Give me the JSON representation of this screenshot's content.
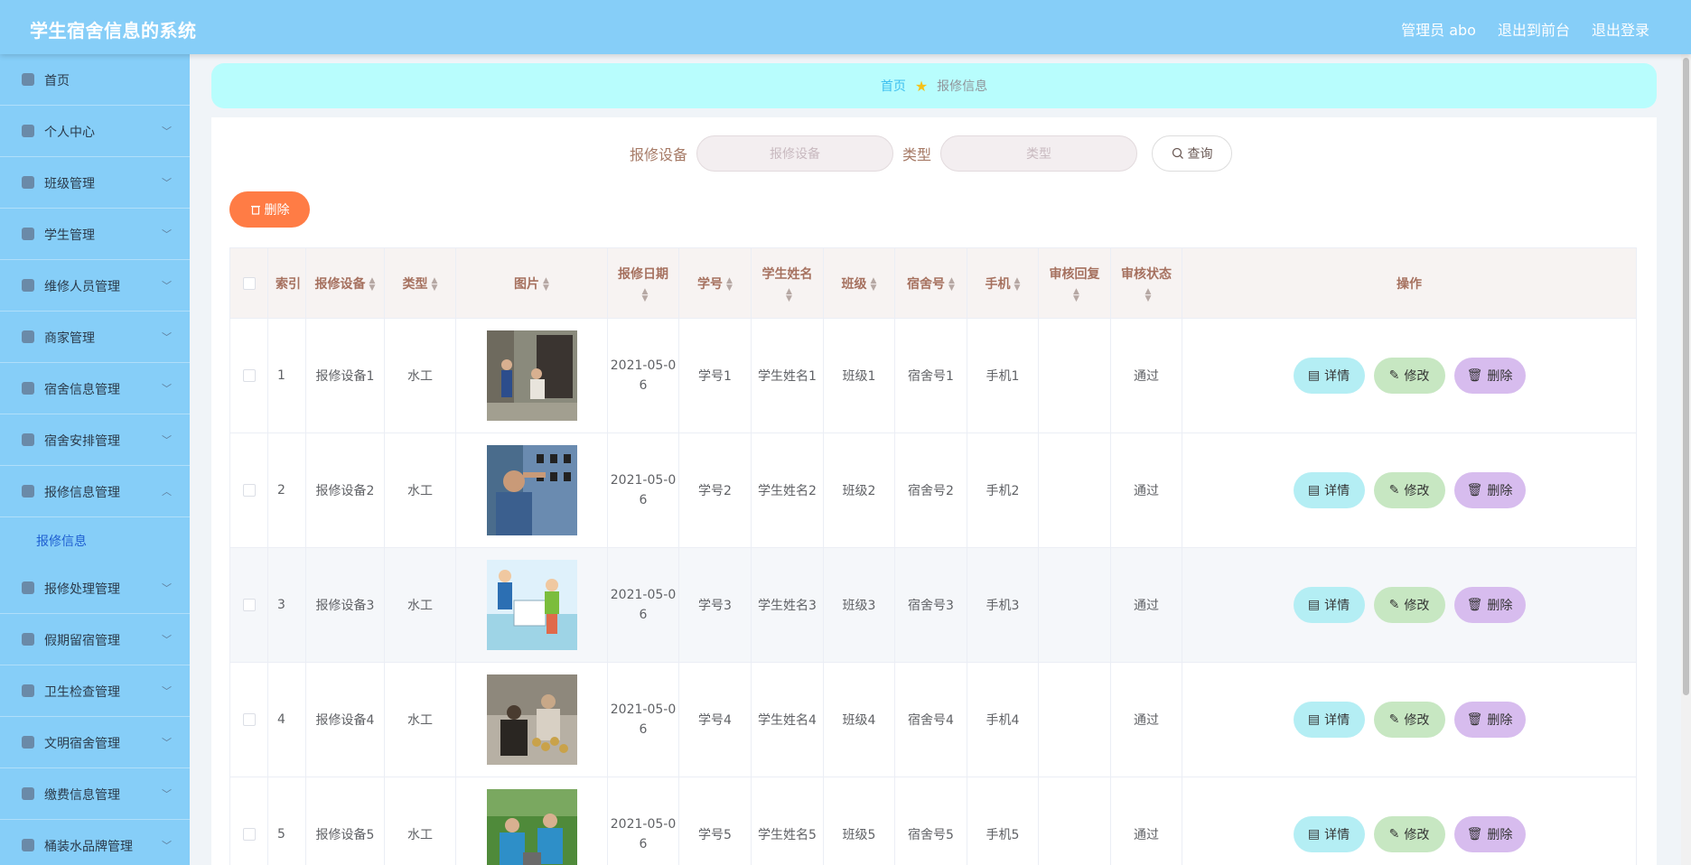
{
  "header": {
    "title": "学生宿舍信息的系统",
    "admin": "管理员 abo",
    "to_front": "退出到前台",
    "logout": "退出登录"
  },
  "sidebar": {
    "items": [
      {
        "label": "首页",
        "icon": "home-icon",
        "chevron": ""
      },
      {
        "label": "个人中心",
        "icon": "user-icon",
        "chevron": "﹀"
      },
      {
        "label": "班级管理",
        "icon": "grid-icon",
        "chevron": "﹀"
      },
      {
        "label": "学生管理",
        "icon": "clipboard-icon",
        "chevron": "﹀"
      },
      {
        "label": "维修人员管理",
        "icon": "tool-icon",
        "chevron": "﹀"
      },
      {
        "label": "商家管理",
        "icon": "mic-icon",
        "chevron": "﹀"
      },
      {
        "label": "宿舍信息管理",
        "icon": "compass-icon",
        "chevron": "﹀"
      },
      {
        "label": "宿舍安排管理",
        "icon": "message-icon",
        "chevron": "﹀"
      },
      {
        "label": "报修信息管理",
        "icon": "send-icon",
        "chevron": "︿"
      }
    ],
    "submenu": "报修信息",
    "items2": [
      {
        "label": "报修处理管理",
        "icon": "chart-icon",
        "chevron": "﹀"
      },
      {
        "label": "假期留宿管理",
        "icon": "location-icon",
        "chevron": "﹀"
      },
      {
        "label": "卫生检查管理",
        "icon": "ticket-icon",
        "chevron": "﹀"
      },
      {
        "label": "文明宿舍管理",
        "icon": "target-icon",
        "chevron": "﹀"
      },
      {
        "label": "缴费信息管理",
        "icon": "circle-icon",
        "chevron": "﹀"
      },
      {
        "label": "桶装水品牌管理",
        "icon": "suitcase-icon",
        "chevron": "﹀"
      }
    ]
  },
  "breadcrumb": {
    "home": "首页",
    "current": "报修信息"
  },
  "search": {
    "label1": "报修设备",
    "placeholder1": "报修设备",
    "label2": "类型",
    "placeholder2": "类型",
    "button": "查询"
  },
  "toolbar": {
    "delete": "删除"
  },
  "table": {
    "headers": [
      "索引",
      "报修设备",
      "类型",
      "图片",
      "报修日期",
      "学号",
      "学生姓名",
      "班级",
      "宿舍号",
      "手机",
      "审核回复",
      "审核状态",
      "操作"
    ],
    "rows": [
      {
        "idx": "1",
        "device": "报修设备1",
        "type": "水工",
        "date1": "2021-05-0",
        "date2": "6",
        "sid": "学号1",
        "name": "学生姓名1",
        "cls": "班级1",
        "room": "宿舍号1",
        "phone": "手机1",
        "reply": "",
        "status": "通过"
      },
      {
        "idx": "2",
        "device": "报修设备2",
        "type": "水工",
        "date1": "2021-05-0",
        "date2": "6",
        "sid": "学号2",
        "name": "学生姓名2",
        "cls": "班级2",
        "room": "宿舍号2",
        "phone": "手机2",
        "reply": "",
        "status": "通过"
      },
      {
        "idx": "3",
        "device": "报修设备3",
        "type": "水工",
        "date1": "2021-05-0",
        "date2": "6",
        "sid": "学号3",
        "name": "学生姓名3",
        "cls": "班级3",
        "room": "宿舍号3",
        "phone": "手机3",
        "reply": "",
        "status": "通过"
      },
      {
        "idx": "4",
        "device": "报修设备4",
        "type": "水工",
        "date1": "2021-05-0",
        "date2": "6",
        "sid": "学号4",
        "name": "学生姓名4",
        "cls": "班级4",
        "room": "宿舍号4",
        "phone": "手机4",
        "reply": "",
        "status": "通过"
      },
      {
        "idx": "5",
        "device": "报修设备5",
        "type": "水工",
        "date1": "2021-05-0",
        "date2": "6",
        "sid": "学号5",
        "name": "学生姓名5",
        "cls": "班级5",
        "room": "宿舍号5",
        "phone": "手机5",
        "reply": "",
        "status": "通过"
      }
    ],
    "actions": {
      "detail": "详情",
      "edit": "修改",
      "delete": "删除"
    }
  }
}
